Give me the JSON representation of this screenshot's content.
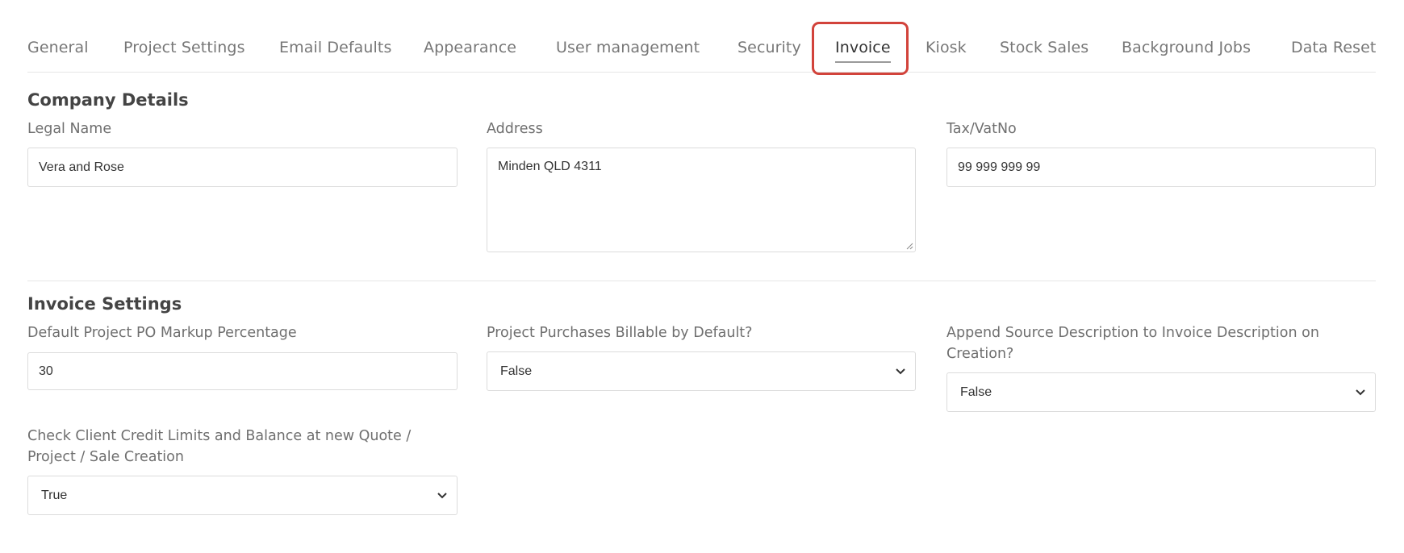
{
  "tabs": [
    {
      "label": "General"
    },
    {
      "label": "Project Settings"
    },
    {
      "label": "Email Defaults"
    },
    {
      "label": "Appearance"
    },
    {
      "label": "User management"
    },
    {
      "label": "Security"
    },
    {
      "label": "Invoice",
      "active": true
    },
    {
      "label": "Kiosk"
    },
    {
      "label": "Stock Sales"
    },
    {
      "label": "Background Jobs"
    },
    {
      "label": "Data Reset"
    }
  ],
  "company_details": {
    "title": "Company Details",
    "legal_name": {
      "label": "Legal Name",
      "value": "Vera and Rose"
    },
    "address": {
      "label": "Address",
      "value": "Minden QLD 4311"
    },
    "tax": {
      "label": "Tax/VatNo",
      "value": "99 999 999 99"
    }
  },
  "invoice_settings": {
    "title": "Invoice Settings",
    "markup": {
      "label": "Default Project PO Markup Percentage",
      "value": "30"
    },
    "billable": {
      "label": "Project Purchases Billable by Default?",
      "value": "False"
    },
    "append_source": {
      "label": "Append Source Description to Invoice Description on Creation?",
      "value": "False"
    },
    "credit_check": {
      "label": "Check Client Credit Limits and Balance at new Quote / Project / Sale Creation",
      "value": "True"
    }
  },
  "colors": {
    "highlight": "#d2433b",
    "active_tab_text": "#333333",
    "inactive_tab_text": "#777777"
  }
}
